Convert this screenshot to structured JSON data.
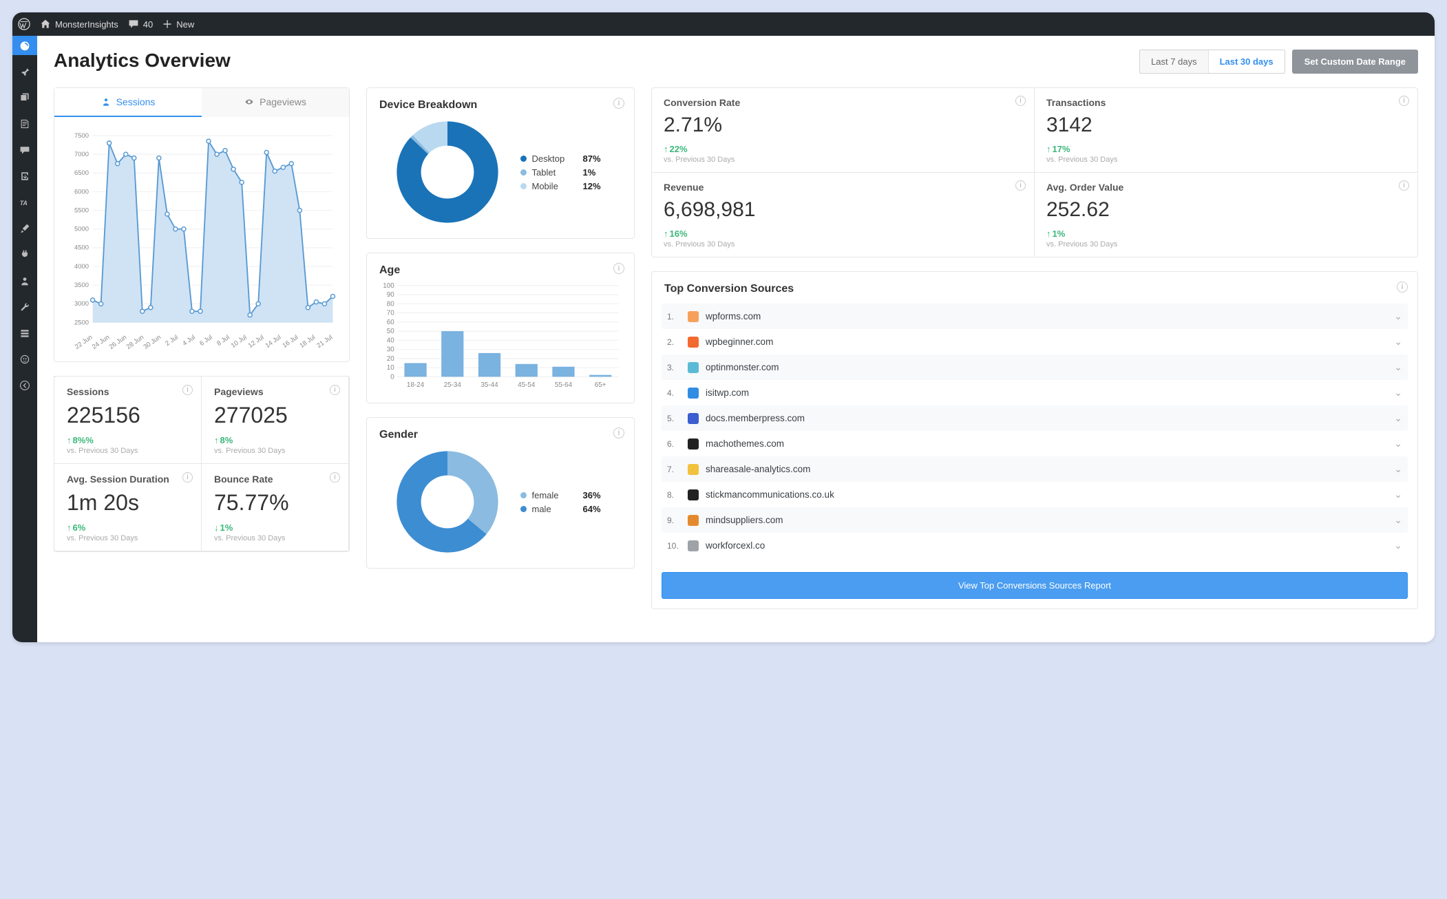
{
  "adminbar": {
    "site_name": "MonsterInsights",
    "comments_count": "40",
    "new_label": "New"
  },
  "page_title": "Analytics Overview",
  "date_controls": {
    "last7": "Last 7 days",
    "last30": "Last 30 days",
    "custom": "Set Custom Date Range",
    "selected": "last30"
  },
  "tabs": {
    "sessions": "Sessions",
    "pageviews": "Pageviews",
    "active": "sessions"
  },
  "chart_data": [
    {
      "id": "sessions_line",
      "type": "line",
      "title": "Sessions",
      "ylabel": "",
      "ylim": [
        2500,
        7500
      ],
      "yticks": [
        2500,
        3000,
        3500,
        4000,
        4500,
        5000,
        5500,
        6000,
        6500,
        7000,
        7500
      ],
      "categories": [
        "22 Jun",
        "24 Jun",
        "26 Jun",
        "28 Jun",
        "30 Jun",
        "2 Jul",
        "4 Jul",
        "6 Jul",
        "8 Jul",
        "10 Jul",
        "12 Jul",
        "14 Jul",
        "16 Jul",
        "18 Jul",
        "21 Jul"
      ],
      "values": [
        3100,
        3000,
        7300,
        6750,
        7000,
        6900,
        2800,
        2900,
        6900,
        5400,
        5000,
        5000,
        2800,
        2800,
        7350,
        7000,
        7100,
        6600,
        6250,
        2700,
        3000,
        7050,
        6550,
        6650,
        6750,
        5500,
        2900,
        3050,
        3000,
        3200
      ],
      "grid": true
    },
    {
      "id": "device_breakdown",
      "type": "pie",
      "title": "Device Breakdown",
      "series": [
        {
          "name": "Desktop",
          "value": 87,
          "color": "#1a73b7"
        },
        {
          "name": "Tablet",
          "value": 1,
          "color": "#8bbbe0"
        },
        {
          "name": "Mobile",
          "value": 12,
          "color": "#b9d9f1"
        }
      ]
    },
    {
      "id": "age_bars",
      "type": "bar",
      "title": "Age",
      "ylim": [
        0,
        100
      ],
      "yticks": [
        0,
        10,
        20,
        30,
        40,
        50,
        60,
        70,
        80,
        90,
        100
      ],
      "categories": [
        "18-24",
        "25-34",
        "35-44",
        "45-54",
        "55-64",
        "65+"
      ],
      "values": [
        15,
        50,
        26,
        14,
        11,
        2
      ],
      "color": "#7ab2e0",
      "grid": true
    },
    {
      "id": "gender_pie",
      "type": "pie",
      "title": "Gender",
      "series": [
        {
          "name": "female",
          "value": 36,
          "color": "#8bbbe0"
        },
        {
          "name": "male",
          "value": 64,
          "color": "#3d8dd2"
        }
      ]
    }
  ],
  "stats": {
    "sessions": {
      "label": "Sessions",
      "value": "225156",
      "delta": "8%%",
      "dir": "up",
      "vs": "vs. Previous 30 Days"
    },
    "pageviews": {
      "label": "Pageviews",
      "value": "277025",
      "delta": "8%",
      "dir": "up",
      "vs": "vs. Previous 30 Days"
    },
    "avg_session": {
      "label": "Avg. Session Duration",
      "value": "1m 20s",
      "delta": "6%",
      "dir": "up",
      "vs": "vs. Previous 30 Days"
    },
    "bounce": {
      "label": "Bounce Rate",
      "value": "75.77%",
      "delta": "1%",
      "dir": "down",
      "vs": "vs. Previous 30 Days"
    },
    "conv_rate": {
      "label": "Conversion Rate",
      "value": "2.71%",
      "delta": "22%",
      "dir": "up",
      "vs": "vs. Previous 30 Days"
    },
    "transactions": {
      "label": "Transactions",
      "value": "3142",
      "delta": "17%",
      "dir": "up",
      "vs": "vs. Previous 30 Days"
    },
    "revenue": {
      "label": "Revenue",
      "value": "6,698,981",
      "delta": "16%",
      "dir": "up",
      "vs": "vs. Previous 30 Days"
    },
    "aov": {
      "label": "Avg. Order Value",
      "value": "252.62",
      "delta": "1%",
      "dir": "up",
      "vs": "vs. Previous 30 Days"
    }
  },
  "card_titles": {
    "device": "Device Breakdown",
    "age": "Age",
    "gender": "Gender",
    "sources": "Top Conversion Sources"
  },
  "sources": {
    "items": [
      {
        "rank": "1.",
        "domain": "wpforms.com",
        "color": "#f7a05b"
      },
      {
        "rank": "2.",
        "domain": "wpbeginner.com",
        "color": "#f26a2e"
      },
      {
        "rank": "3.",
        "domain": "optinmonster.com",
        "color": "#5bbad5"
      },
      {
        "rank": "4.",
        "domain": "isitwp.com",
        "color": "#2f8de4"
      },
      {
        "rank": "5.",
        "domain": "docs.memberpress.com",
        "color": "#3b5ed0"
      },
      {
        "rank": "6.",
        "domain": "machothemes.com",
        "color": "#222"
      },
      {
        "rank": "7.",
        "domain": "shareasale-analytics.com",
        "color": "#f2c23e"
      },
      {
        "rank": "8.",
        "domain": "stickmancommunications.co.uk",
        "color": "#222"
      },
      {
        "rank": "9.",
        "domain": "mindsuppliers.com",
        "color": "#e48a2e"
      },
      {
        "rank": "10.",
        "domain": "workforcexl.co",
        "color": "#9ea3a8"
      }
    ],
    "button": "View Top Conversions Sources Report"
  }
}
